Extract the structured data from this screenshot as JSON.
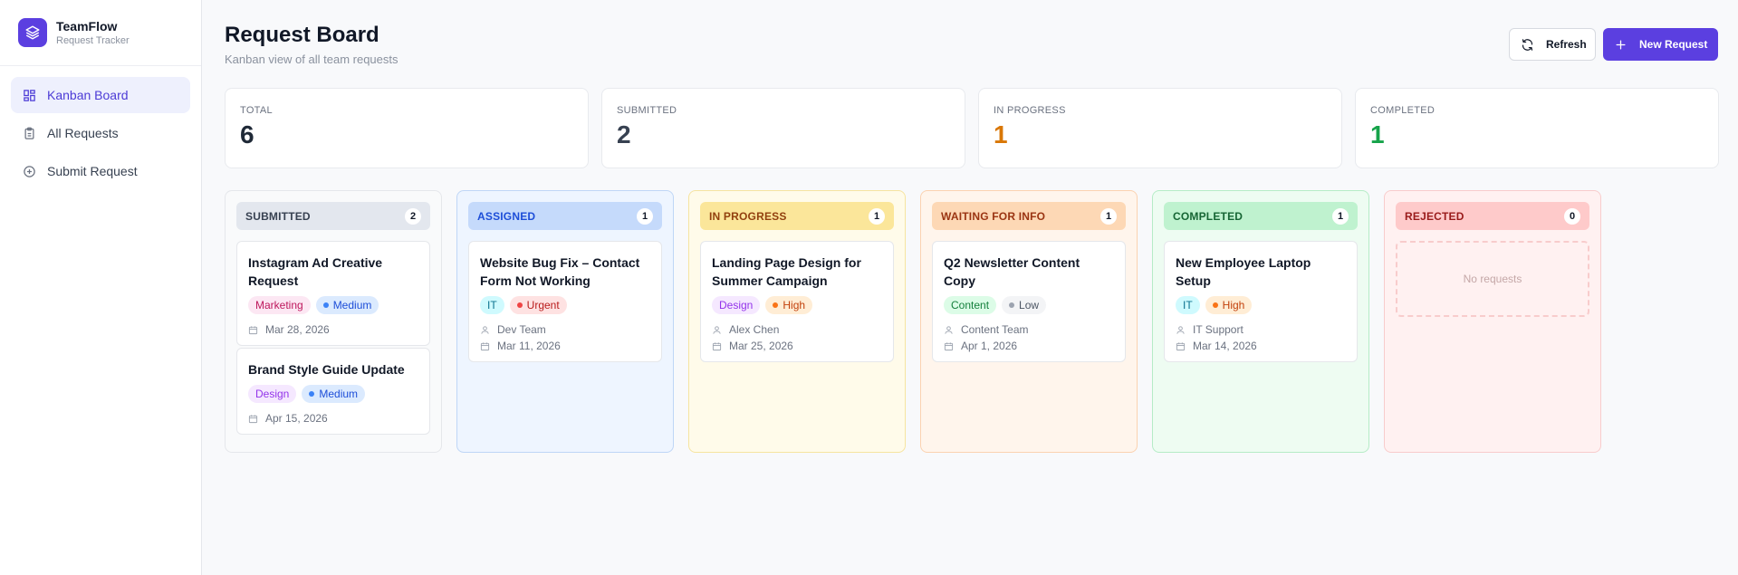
{
  "brand": {
    "name": "TeamFlow",
    "subtitle": "Request Tracker"
  },
  "sidebar": {
    "items": [
      {
        "label": "Kanban Board",
        "icon": "kanban-icon",
        "active": true
      },
      {
        "label": "All Requests",
        "icon": "clipboard-icon",
        "active": false
      },
      {
        "label": "Submit Request",
        "icon": "plus-circle-icon",
        "active": false
      }
    ]
  },
  "header": {
    "title": "Request Board",
    "subtitle": "Kanban view of all team requests",
    "refresh_label": "Refresh",
    "new_label": "New Request"
  },
  "stats": [
    {
      "label": "TOTAL",
      "value": "6",
      "color": "#1f2937"
    },
    {
      "label": "SUBMITTED",
      "value": "2",
      "color": "#374151"
    },
    {
      "label": "IN PROGRESS",
      "value": "1",
      "color": "#d97706"
    },
    {
      "label": "COMPLETED",
      "value": "1",
      "color": "#16a34a"
    }
  ],
  "columns": [
    {
      "title": "SUBMITTED",
      "count": "2",
      "colors": {
        "bg": "#f9fafb",
        "border": "#e5e7eb",
        "head": "#e3e7ee",
        "text": "#374151"
      },
      "cards": [
        {
          "title": "Instagram Ad Creative Request",
          "category": "Marketing",
          "priority": "Medium",
          "assignee": "",
          "date": "Mar 28, 2026"
        },
        {
          "title": "Brand Style Guide Update",
          "category": "Design",
          "priority": "Medium",
          "assignee": "",
          "date": "Apr 15, 2026"
        }
      ]
    },
    {
      "title": "ASSIGNED",
      "count": "1",
      "colors": {
        "bg": "#eef5ff",
        "border": "#bfd6f6",
        "head": "#c5dafb",
        "text": "#1d4ed8"
      },
      "cards": [
        {
          "title": "Website Bug Fix – Contact Form Not Working",
          "category": "IT",
          "priority": "Urgent",
          "assignee": "Dev Team",
          "date": "Mar 11, 2026"
        }
      ]
    },
    {
      "title": "IN PROGRESS",
      "count": "1",
      "colors": {
        "bg": "#fffbea",
        "border": "#f6e4a0",
        "head": "#fbe69a",
        "text": "#92400e"
      },
      "cards": [
        {
          "title": "Landing Page Design for Summer Campaign",
          "category": "Design",
          "priority": "High",
          "assignee": "Alex Chen",
          "date": "Mar 25, 2026"
        }
      ]
    },
    {
      "title": "WAITING FOR INFO",
      "count": "1",
      "colors": {
        "bg": "#fff5ec",
        "border": "#fbd2b0",
        "head": "#fdd8b5",
        "text": "#9a3412"
      },
      "cards": [
        {
          "title": "Q2 Newsletter Content Copy",
          "category": "Content",
          "priority": "Low",
          "assignee": "Content Team",
          "date": "Apr 1, 2026"
        }
      ]
    },
    {
      "title": "COMPLETED",
      "count": "1",
      "colors": {
        "bg": "#eefcf2",
        "border": "#b6ecc7",
        "head": "#bff2cf",
        "text": "#166534"
      },
      "cards": [
        {
          "title": "New Employee Laptop Setup",
          "category": "IT",
          "priority": "High",
          "assignee": "IT Support",
          "date": "Mar 14, 2026"
        }
      ]
    },
    {
      "title": "REJECTED",
      "count": "0",
      "colors": {
        "bg": "#fff1f1",
        "border": "#f8cccc",
        "head": "#fecaca",
        "text": "#991b1b"
      },
      "cards": [],
      "empty_label": "No requests"
    }
  ],
  "category_colors": {
    "Marketing": {
      "bg": "#fce7f3",
      "text": "#be185d"
    },
    "Design": {
      "bg": "#f5e8ff",
      "text": "#9333ea"
    },
    "IT": {
      "bg": "#cffafe",
      "text": "#0e7490"
    },
    "Content": {
      "bg": "#dcfce7",
      "text": "#15803d"
    }
  },
  "priority_colors": {
    "Medium": {
      "bg": "#dbeafe",
      "text": "#1d4ed8",
      "dot": "#3b82f6"
    },
    "Urgent": {
      "bg": "#fee2e2",
      "text": "#b91c1c",
      "dot": "#ef4444"
    },
    "High": {
      "bg": "#ffedd5",
      "text": "#c2410c",
      "dot": "#f97316"
    },
    "Low": {
      "bg": "#f3f4f6",
      "text": "#4b5563",
      "dot": "#9ca3af"
    }
  }
}
